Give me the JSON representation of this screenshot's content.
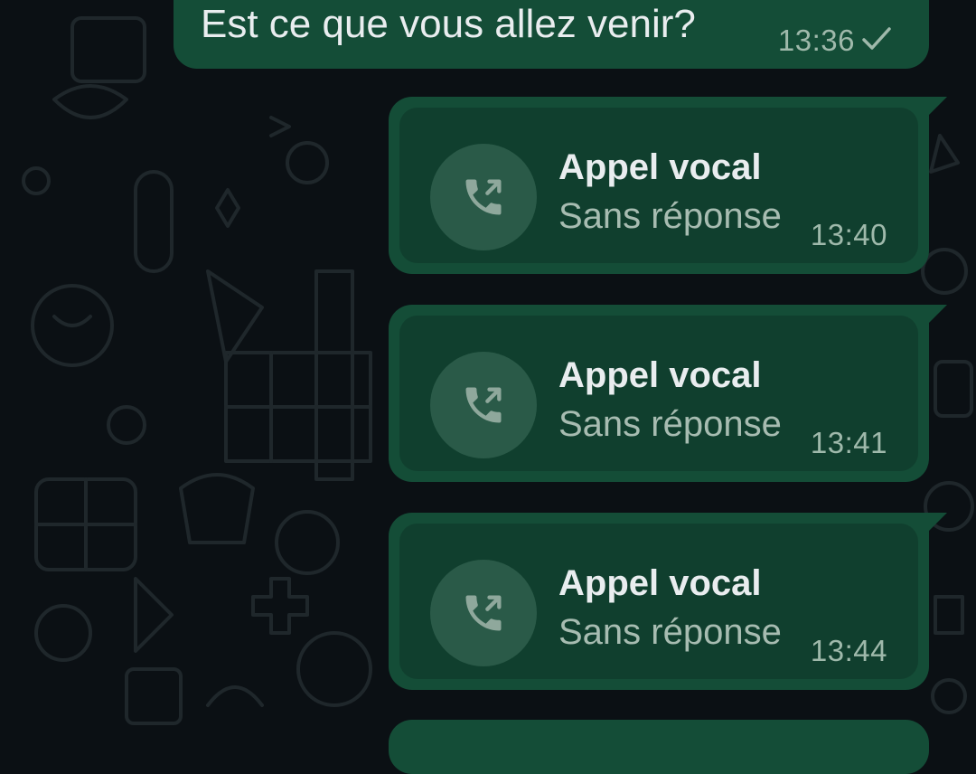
{
  "messages": [
    {
      "text": "Est ce que vous allez venir?",
      "time": "13:36"
    }
  ],
  "calls": [
    {
      "title": "Appel vocal",
      "status": "Sans réponse",
      "time": "13:40"
    },
    {
      "title": "Appel vocal",
      "status": "Sans réponse",
      "time": "13:41"
    },
    {
      "title": "Appel vocal",
      "status": "Sans réponse",
      "time": "13:44"
    }
  ],
  "icons": {
    "sent": "check-icon",
    "call": "outgoing-call-icon"
  },
  "colors": {
    "background": "#0b1014",
    "bubble": "#144d37",
    "bubble_inner": "#103f2e",
    "text": "#e9edef",
    "meta": "#9fb9ab"
  }
}
